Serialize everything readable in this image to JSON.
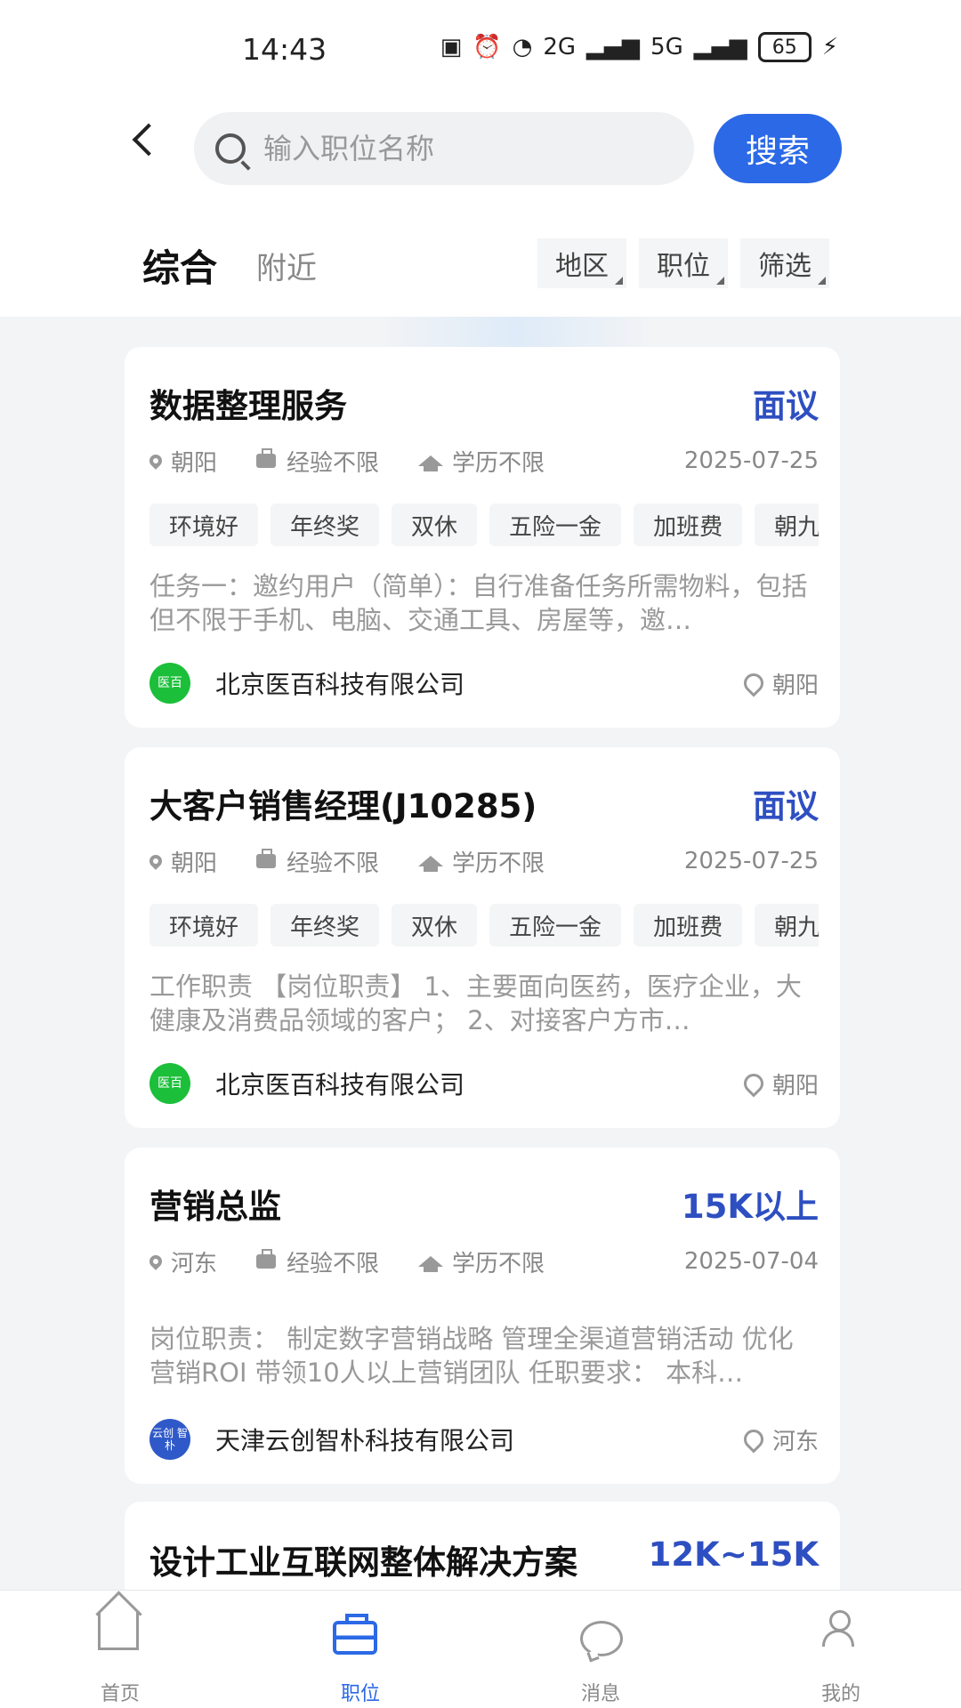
{
  "status_bar": {
    "time": "14:43",
    "battery": "65",
    "network_5g": "5G",
    "network_2g": "2G"
  },
  "search": {
    "placeholder": "输入职位名称",
    "button_label": "搜索"
  },
  "tabs": {
    "main": "综合",
    "nearby": "附近"
  },
  "filters": [
    "地区",
    "职位",
    "筛选"
  ],
  "jobs": [
    {
      "title": "数据整理服务",
      "salary": "面议",
      "location": "朝阳",
      "experience": "经验不限",
      "education": "学历不限",
      "date": "2025-07-25",
      "tags": [
        "环境好",
        "年终奖",
        "双休",
        "五险一金",
        "加班费",
        "朝九"
      ],
      "description": "任务一：邀约用户（简单）：自行准备任务所需物料，包括但不限于手机、电脑、交通工具、房屋等，邀…",
      "company": "北京医百科技有限公司",
      "company_logo": "医百",
      "company_location": "朝阳"
    },
    {
      "title": "大客户销售经理(J10285)",
      "salary": "面议",
      "location": "朝阳",
      "experience": "经验不限",
      "education": "学历不限",
      "date": "2025-07-25",
      "tags": [
        "环境好",
        "年终奖",
        "双休",
        "五险一金",
        "加班费",
        "朝九"
      ],
      "description": "工作职责 【岗位职责】 1、主要面向医药，医疗企业，大健康及消费品领域的客户； 2、对接客户方市…",
      "company": "北京医百科技有限公司",
      "company_logo": "医百",
      "company_location": "朝阳"
    },
    {
      "title": "营销总监",
      "salary": "15K以上",
      "location": "河东",
      "experience": "经验不限",
      "education": "学历不限",
      "date": "2025-07-04",
      "description": "岗位职责： 制定数字营销战略 管理全渠道营销活动 优化营销ROI 带领10人以上营销团队 任职要求： 本科…",
      "company": "天津云创智朴科技有限公司",
      "company_logo": "云创 智朴",
      "company_location": "河东"
    },
    {
      "title": "设计工业互联网整体解决方案",
      "salary": "12K~15K"
    }
  ],
  "bottom_nav": {
    "home": "首页",
    "jobs": "职位",
    "messages": "消息",
    "mine": "我的"
  },
  "colors": {
    "primary": "#2b69e6",
    "salary": "#2e4fc1",
    "logo_green": "#1bbf3a",
    "logo_blue": "#2f59c9"
  }
}
